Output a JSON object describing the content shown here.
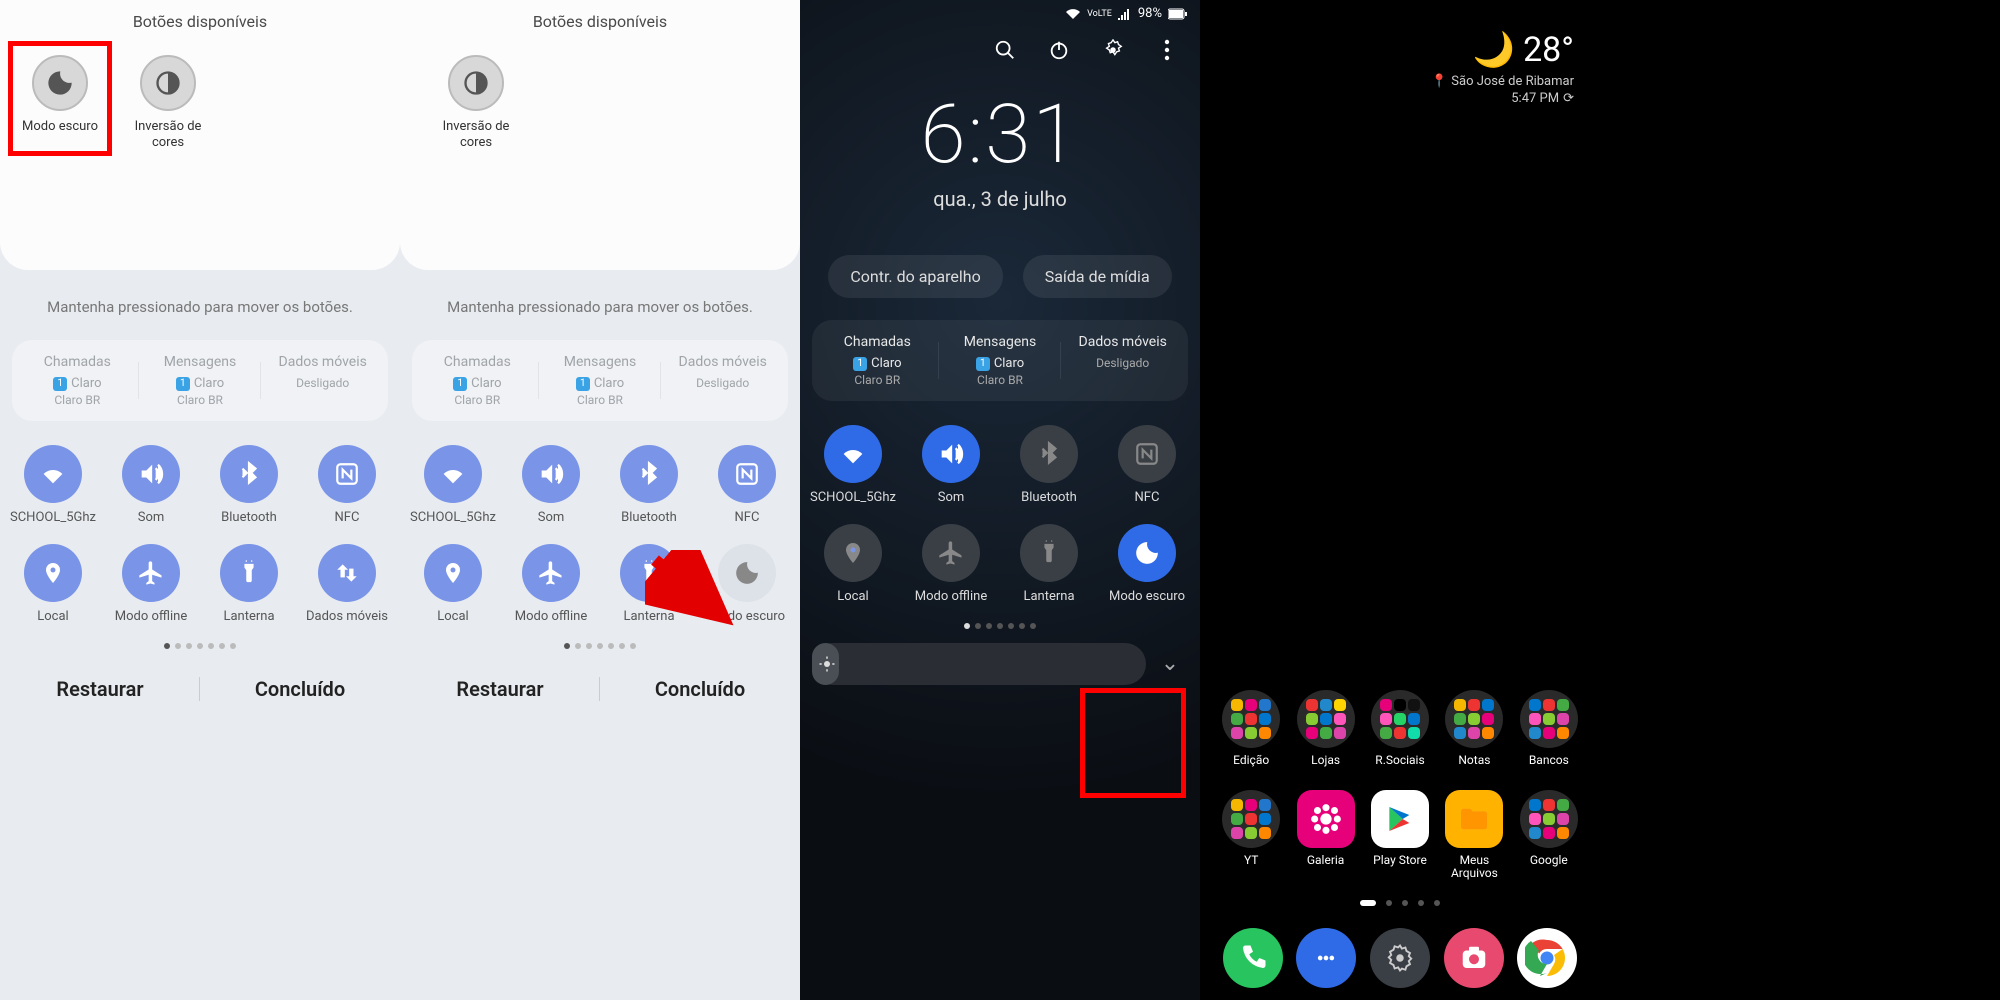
{
  "panel1": {
    "title": "Botões disponíveis",
    "available": [
      {
        "label": "Modo escuro",
        "icon": "moon"
      },
      {
        "label": "Inversão de cores",
        "icon": "contrast"
      }
    ]
  },
  "panel2": {
    "title": "Botões disponíveis",
    "available": [
      {
        "label": "Inversão de cores",
        "icon": "contrast"
      }
    ]
  },
  "shared_light": {
    "hint": "Mantenha pressionado para mover os botões.",
    "sim": {
      "calls": {
        "title": "Chamadas",
        "carrier": "Claro",
        "sub": "Claro BR"
      },
      "msgs": {
        "title": "Mensagens",
        "carrier": "Claro",
        "sub": "Claro BR"
      },
      "data": {
        "title": "Dados móveis",
        "status": "Desligado"
      }
    },
    "qs_row1": [
      {
        "label": "SCHOOL_5Ghz",
        "icon": "wifi",
        "on": true
      },
      {
        "label": "Som",
        "icon": "sound",
        "on": true
      },
      {
        "label": "Bluetooth",
        "icon": "bluetooth",
        "on": true
      },
      {
        "label": "NFC",
        "icon": "nfc",
        "on": true
      }
    ],
    "qs_row2_p1": [
      {
        "label": "Local",
        "icon": "location",
        "on": true
      },
      {
        "label": "Modo offline",
        "icon": "plane",
        "on": true
      },
      {
        "label": "Lanterna",
        "icon": "flashlight",
        "on": true
      },
      {
        "label": "Dados móveis",
        "icon": "swap",
        "on": true
      }
    ],
    "qs_row2_p2": [
      {
        "label": "Local",
        "icon": "location",
        "on": true
      },
      {
        "label": "Modo offline",
        "icon": "plane",
        "on": true
      },
      {
        "label": "Lanterna",
        "icon": "flashlight",
        "on": true
      },
      {
        "label": "Modo escuro",
        "icon": "moon",
        "on": false
      }
    ],
    "restore": "Restaurar",
    "done": "Concluído"
  },
  "panel3": {
    "battery": "98%",
    "header_icons": [
      "search",
      "power",
      "settings",
      "more"
    ],
    "time": "6:31",
    "date": "qua., 3 de julho",
    "chip_device": "Contr. do aparelho",
    "chip_media": "Saída de mídia",
    "sim": {
      "calls": {
        "title": "Chamadas",
        "carrier": "Claro",
        "sub": "Claro BR"
      },
      "msgs": {
        "title": "Mensagens",
        "carrier": "Claro",
        "sub": "Claro BR"
      },
      "data": {
        "title": "Dados móveis",
        "status": "Desligado"
      }
    },
    "qs_row1": [
      {
        "label": "SCHOOL_5Ghz",
        "icon": "wifi",
        "on": true
      },
      {
        "label": "Som",
        "icon": "sound",
        "on": true
      },
      {
        "label": "Bluetooth",
        "icon": "bluetooth",
        "on": false
      },
      {
        "label": "NFC",
        "icon": "nfc",
        "on": false
      }
    ],
    "qs_row2": [
      {
        "label": "Local",
        "icon": "location",
        "on": false
      },
      {
        "label": "Modo offline",
        "icon": "plane",
        "on": false
      },
      {
        "label": "Lanterna",
        "icon": "flashlight",
        "on": false
      },
      {
        "label": "Modo escuro",
        "icon": "moon",
        "on": true
      }
    ]
  },
  "panel4": {
    "weather": {
      "temp": "28°",
      "location": "São José de Ribamar",
      "time": "5:47 PM"
    },
    "folders_row1": [
      "Edição",
      "Lojas",
      "R.Sociais",
      "Notas",
      "Bancos"
    ],
    "row2": [
      {
        "label": "YT",
        "type": "folder"
      },
      {
        "label": "Galeria",
        "type": "icon",
        "color": "#e6007a"
      },
      {
        "label": "Play Store",
        "type": "icon",
        "color": "#fff"
      },
      {
        "label": "Meus Arquivos",
        "type": "icon",
        "color": "#ffb300"
      },
      {
        "label": "Google",
        "type": "folder"
      }
    ],
    "dock": [
      {
        "name": "phone",
        "color": "#27c45f"
      },
      {
        "name": "messages",
        "color": "#2f6be6"
      },
      {
        "name": "settings",
        "color": "#3a3f46"
      },
      {
        "name": "camera",
        "color": "#e84a6f"
      },
      {
        "name": "chrome",
        "color": "#fff"
      }
    ]
  }
}
